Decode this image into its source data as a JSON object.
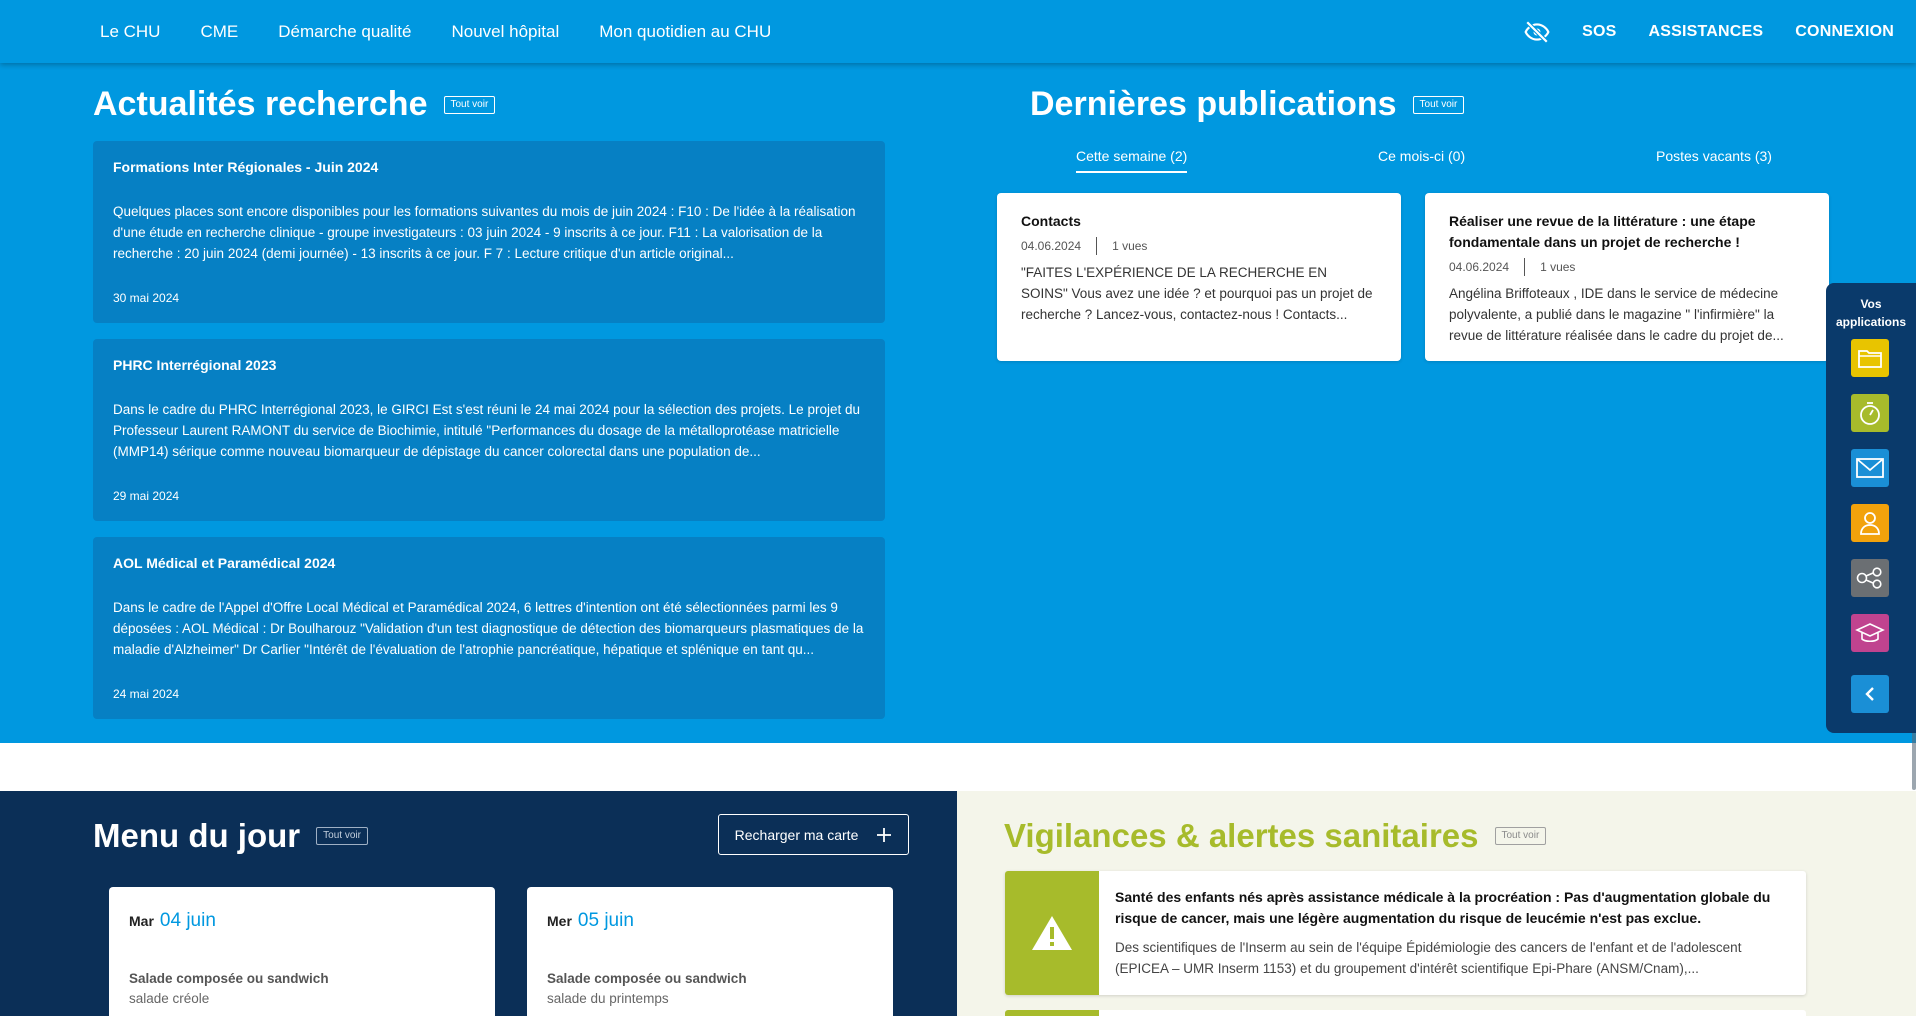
{
  "nav": {
    "items": [
      "Le CHU",
      "CME",
      "Démarche qualité",
      "Nouvel hôpital",
      "Mon quotidien au CHU"
    ],
    "right": {
      "sos": "SOS",
      "assistances": "ASSISTANCES",
      "connexion": "CONNEXION"
    }
  },
  "research": {
    "title": "Actualités recherche",
    "tout_voir": "Tout voir",
    "cards": [
      {
        "title": "Formations Inter Régionales - Juin 2024",
        "body": "Quelques places sont encore disponibles pour les formations suivantes du mois de juin 2024 : F10 : De l'idée à la réalisation d'une étude en recherche clinique - groupe investigateurs : 03 juin 2024 - 9 inscrits à ce jour. F11 : La valorisation de la recherche : 20 juin 2024 (demi journée) - 13 inscrits à ce jour. F 7 : Lecture critique d'un article original...",
        "date": "30 mai 2024"
      },
      {
        "title": "PHRC Interrégional 2023",
        "body": "Dans le cadre du PHRC Interrégional 2023, le GIRCI Est s'est réuni le 24 mai 2024 pour la sélection des projets. Le projet du Professeur Laurent RAMONT du service de Biochimie, intitulé \"Performances du dosage de la métalloprotéase matricielle (MMP14) sérique comme nouveau biomarqueur de dépistage du cancer colorectal dans une population de...",
        "date": "29 mai 2024"
      },
      {
        "title": "AOL Médical et Paramédical 2024",
        "body": "Dans le cadre de l'Appel d'Offre Local Médical et Paramédical 2024, 6 lettres d'intention ont été sélectionnées parmi les 9 déposées : AOL Médical : Dr Boulharouz \"Validation d'un test diagnostique de détection des biomarqueurs plasmatiques de la maladie d'Alzheimer\" Dr Carlier \"Intérêt de l'évaluation de l'atrophie pancréatique, hépatique et splénique en tant qu...",
        "date": "24 mai 2024"
      }
    ]
  },
  "publications": {
    "title": "Dernières publications",
    "tout_voir": "Tout voir",
    "tabs": [
      "Cette semaine (2)",
      "Ce mois-ci (0)",
      "Postes vacants (3)"
    ],
    "cards": [
      {
        "title": "Contacts",
        "date": "04.06.2024",
        "views": "1 vues",
        "body": "\"FAITES L'EXPÉRIENCE DE LA RECHERCHE EN SOINS\" Vous avez une idée ? et pourquoi pas un projet de recherche ? Lancez-vous, contactez-nous ! Contacts..."
      },
      {
        "title": "Réaliser une revue de la littérature : une étape fondamentale dans un projet de recherche !",
        "date": "04.06.2024",
        "views": "1 vues",
        "body": "Angélina Briffoteaux , IDE dans le service de médecine polyvalente, a publié dans le magazine \" l'infirmière\" la revue de littérature réalisée dans le cadre du projet de..."
      }
    ]
  },
  "apps_panel": {
    "title_line1": "Vos",
    "title_line2": "applications",
    "apps": [
      {
        "icon": "folder-icon",
        "color": "#e8c400"
      },
      {
        "icon": "timer-icon",
        "color": "#a7bb2b"
      },
      {
        "icon": "mail-icon",
        "color": "#1a8fd6"
      },
      {
        "icon": "user-icon",
        "color": "#f2a20c"
      },
      {
        "icon": "network-icon",
        "color": "#6b6f73"
      },
      {
        "icon": "graduation-cap-icon",
        "color": "#c0438f"
      },
      {
        "icon": "chevron-left-icon",
        "color": "#1a8fd6"
      }
    ]
  },
  "menu": {
    "title": "Menu du jour",
    "tout_voir": "Tout voir",
    "reload_label": "Recharger ma carte",
    "days": [
      {
        "day": "Mar",
        "date": "04 juin",
        "label": "Salade composée ou sandwich",
        "value": "salade créole"
      },
      {
        "day": "Mer",
        "date": "05 juin",
        "label": "Salade composée ou sandwich",
        "value": "salade du printemps"
      }
    ]
  },
  "vigilances": {
    "title": "Vigilances & alertes sanitaires",
    "tout_voir": "Tout voir",
    "alert": {
      "title": "Santé des enfants nés après assistance médicale à la procréation : Pas d'augmentation globale du risque de cancer, mais une légère augmentation du risque de leucémie n'est pas exclue.",
      "body": "Des scientifiques de l'Inserm au sein de l'équipe Épidémiologie des cancers de l'enfant et de l'adolescent (EPICEA – UMR Inserm 1153) et du groupement d'intérêt scientifique Epi-Phare (ANSM/Cnam),..."
    }
  },
  "colors": {
    "primary_blue": "#0098e0",
    "card_blue": "#0680c4",
    "navy": "#0b2f57",
    "green": "#a7bb2b"
  }
}
